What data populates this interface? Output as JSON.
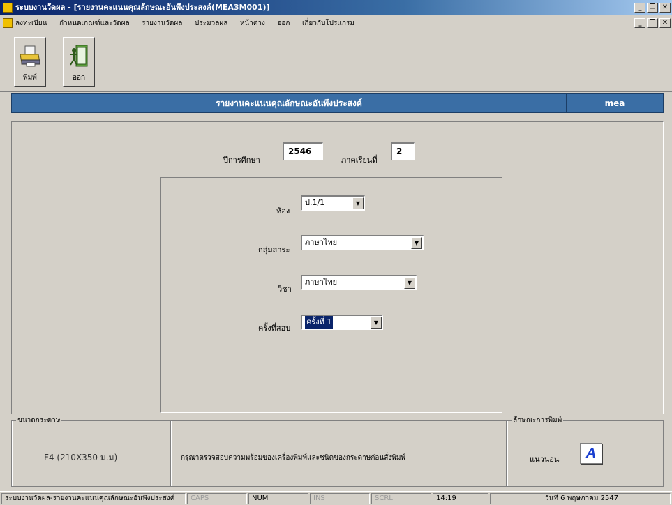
{
  "window": {
    "title": "ระบบงานวัดผล - [รายงานคะแนนคุณลักษณะอันพึงประสงค์(MEA3M001)]",
    "controls": [
      "_",
      "❐",
      "✕"
    ]
  },
  "menu": {
    "items": [
      "ลงทะเบียน",
      "กำหนดเกณฑ์และวัดผล",
      "รายงานวัดผล",
      "ประมวลผล",
      "หน้าต่าง",
      "ออก",
      "เกี่ยวกับโปรแกรม"
    ],
    "controls": [
      "_",
      "❐",
      "✕"
    ]
  },
  "toolbar": {
    "print_label": "พิมพ์",
    "exit_label": "ออก",
    "print_icon": "printer-icon",
    "exit_icon": "exit-door-icon"
  },
  "header": {
    "title": "รายงานคะแนนคุณลักษณะอันพึงประสงค์",
    "user": "mea"
  },
  "form": {
    "year_label": "ปีการศึกษา",
    "year_value": "2546",
    "term_label": "ภาคเรียนที่",
    "term_value": "2",
    "room_label": "ห้อง",
    "room_value": "ป.1/1",
    "group_label": "กลุ่มสาระ",
    "group_value": "ภาษาไทย",
    "subject_label": "วิชา",
    "subject_value": "ภาษาไทย",
    "exam_label": "ครั้งที่สอบ",
    "exam_value": "ครั้งที่ 1"
  },
  "paper": {
    "legend": "ขนาดกระดาษ",
    "value": "F4 (210X350 ม.ม)"
  },
  "notice": {
    "text": "กรุณาตรวจสอบความพร้อมของเครื่องพิมพ์และชนิดของกระดาษก่อนสั่งพิมพ์"
  },
  "orientation": {
    "legend": "ลักษณะการพิมพ์",
    "value": "แนวนอน",
    "icon_letter": "A"
  },
  "statusbar": {
    "module": "ระบบงานวัดผล-รายงานคะแนนคุณลักษณะอันพึงประสงค์",
    "caps": "CAPS",
    "num": "NUM",
    "ins": "INS",
    "scrl": "SCRL",
    "time": "14:19",
    "date": "วันที่ 6 พฤษภาคม 2547"
  },
  "colors": {
    "title_bar": "#0a246a",
    "header_band": "#3a6ea5",
    "window_bg": "#d4d0c8"
  }
}
